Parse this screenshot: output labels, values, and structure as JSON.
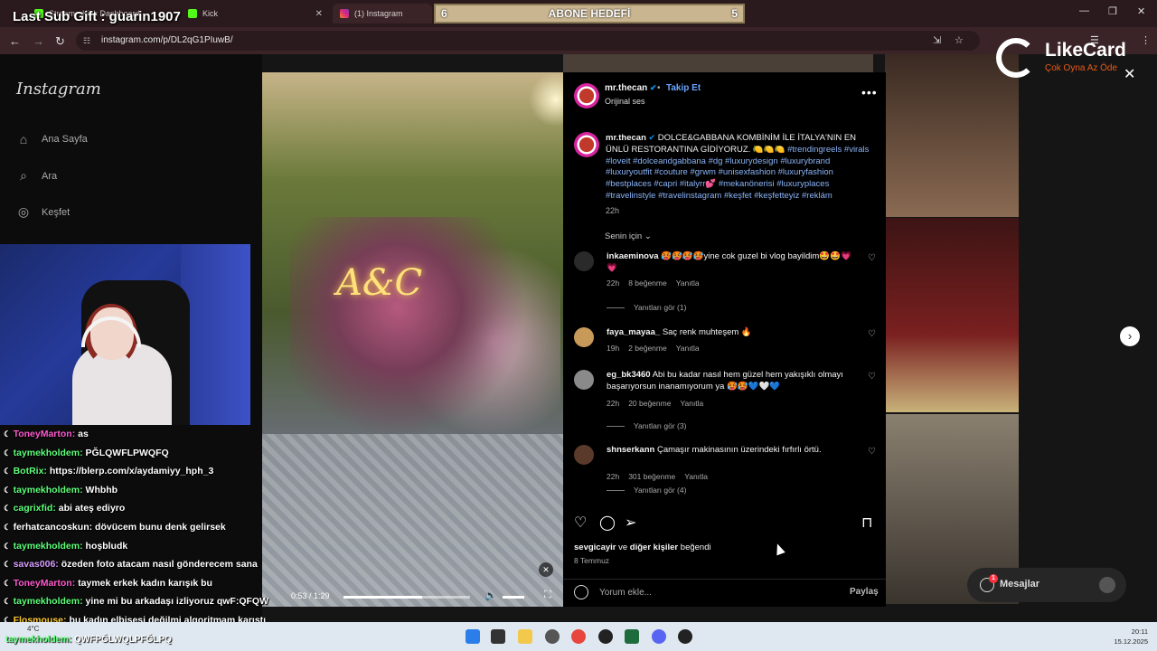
{
  "browser": {
    "tabs": [
      {
        "label": "Stream · Kick Dashboard",
        "active": false
      },
      {
        "label": "Kick",
        "active": false
      },
      {
        "label": "(1) Instagram",
        "active": true
      }
    ],
    "url": "instagram.com/p/DL2qG1PIuwB/"
  },
  "stream_overlay": {
    "last_sub_gift": "Last Sub Gift : guarin1907",
    "abone": {
      "left": "6",
      "label": "ABONE HEDEFİ",
      "right": "5"
    },
    "brand": "LikeCard",
    "slogan": "Çok Oyna Az Öde"
  },
  "ig_sidebar": {
    "logo": "Instagram",
    "items": [
      {
        "label": "Ana Sayfa",
        "icon": "home-icon"
      },
      {
        "label": "Ara",
        "icon": "search-icon"
      },
      {
        "label": "Keşfet",
        "icon": "compass-icon"
      }
    ]
  },
  "chat": [
    {
      "user": "ToneyMarton:",
      "msg": "as",
      "color": "#ff5ad0"
    },
    {
      "user": "taymekholdem:",
      "msg": "PĞLQWFLPWQFQ",
      "color": "#5eff7a"
    },
    {
      "user": "BotRix:",
      "msg": "https://blerp.com/x/aydamiyy_hph_3",
      "color": "#5eff7a"
    },
    {
      "user": "taymekholdem:",
      "msg": "Whbhb",
      "color": "#5eff7a"
    },
    {
      "user": "cagrixfid:",
      "msg": "abi ateş ediyro",
      "color": "#5eff7a"
    },
    {
      "user": "ferhatcancoskun:",
      "msg": "dövücem bunu denk gelirsek",
      "color": "#ffffff"
    },
    {
      "user": "taymekholdem:",
      "msg": "hoşbludk",
      "color": "#5eff7a"
    },
    {
      "user": "savas006:",
      "msg": "özeden foto atacam nasıl gönderecem sana",
      "color": "#d79cff"
    },
    {
      "user": "ToneyMarton:",
      "msg": "taymek erkek kadın karışık bu",
      "color": "#ff5ad0"
    },
    {
      "user": "taymekholdem:",
      "msg": "yine mi bu arkadaşı izliyoruz qwF:QFQW",
      "color": "#5eff7a"
    },
    {
      "user": "Flosmouse:",
      "msg": "bu kadın elbisesi değilmi algoritmam karıştı",
      "color": "#ffcc33"
    }
  ],
  "bottom_chat": {
    "user": "taymekholdem:",
    "msg": "QWFPĞLWQLPFĞLPQ"
  },
  "video": {
    "time": "0:53 / 1:29",
    "progress": 0.62
  },
  "post": {
    "author": "mr.thecan",
    "follow": "Takip Et",
    "audio": "Orijinal ses",
    "caption_text": "DOLCE&GABBANA KOMBİNİM İLE İTALYA'NIN EN ÜNLÜ RESTORANTINA GİDİYORUZ. 🍋🍋🍋",
    "caption_tags": "#trendingreels #virals #loveit #dolceandgabbana #dg #luxurydesign #luxurybrand #luxuryoutfit #couture #grwm #unisexfashion #luxuryfashion #bestplaces #capri #italyrr💕 #mekanönerisi #luxuryplaces #travelinstyle #travelinstagram #keşfet #keşfetteyiz #reklám",
    "caption_time": "22h",
    "sort": "Senin için",
    "likes_user": "sevgicayir",
    "likes_text": " ve ",
    "likes_others": "diğer kişiler",
    "likes_suffix": " beğendi",
    "date": "8 Temmuz",
    "comment_placeholder": "Yorum ekle...",
    "share": "Paylaş"
  },
  "comments": [
    {
      "user": "inkaeminova",
      "text": "🥵🥵🥵🥵yine cok guzel bi vlog bayildim🤩🤩💗💗",
      "time": "22h",
      "likes": "8 beğenme",
      "reply": "Yanıtla",
      "see_replies": "Yanıtları gör (1)"
    },
    {
      "user": "faya_mayaa_",
      "text": "Saç renk muhteşem 🔥",
      "time": "19h",
      "likes": "2 beğenme",
      "reply": "Yanıtla",
      "see_replies": ""
    },
    {
      "user": "eg_bk3460",
      "text": "Abi bu kadar nasıl hem güzel hem yakışıklı olmayı başarıyorsun inanamıyorum ya 🥵🥵💙🤍💙",
      "time": "22h",
      "likes": "20 beğenme",
      "reply": "Yanıtla",
      "see_replies": "Yanıtları gör (3)"
    },
    {
      "user": "shnserkann",
      "text": "Çamaşır makinasının üzerindeki fırfırlı örtü.",
      "time": "22h",
      "likes": "301 beğenme",
      "reply": "Yanıtla",
      "see_replies": "Yanıtları gör (4)"
    }
  ],
  "messages": {
    "label": "Mesajlar",
    "badge": "1"
  },
  "taskbar": {
    "temp": "4°C",
    "time": "20:11",
    "date": "15.12.2025"
  }
}
